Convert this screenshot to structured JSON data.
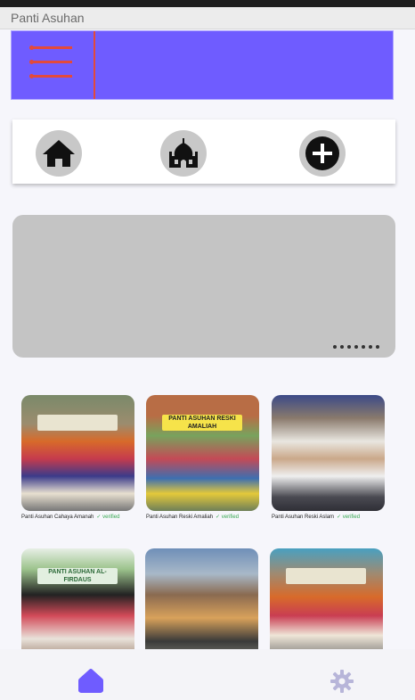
{
  "window": {
    "title": "Panti Asuhan"
  },
  "header": {
    "menu_icon": "hamburger-menu-icon",
    "background": "#6f5cff",
    "accent": "#e24a3b"
  },
  "nav": [
    {
      "icon": "home-icon"
    },
    {
      "icon": "mosque-icon"
    },
    {
      "icon": "add-circle-icon"
    }
  ],
  "banner": {
    "dot_count": 7
  },
  "panti": [
    {
      "name": "Panti Asuhan Cahaya Amanah",
      "badge": "✓ verified"
    },
    {
      "name": "Panti Asuhan Reski Amaliah",
      "badge": "✓ verified",
      "sign": "PANTI ASUHAN RESKI AMALIAH"
    },
    {
      "name": "Panti Asuhan Reski Aslam",
      "badge": "✓ verified"
    },
    {
      "name": "",
      "badge": "",
      "sign": "PANTI ASUHAN AL-FIRDAUS"
    },
    {
      "name": "",
      "badge": ""
    },
    {
      "name": "",
      "badge": ""
    }
  ],
  "bottom_nav": [
    {
      "icon": "home-icon",
      "active": true,
      "color": "#6f5cff"
    },
    {
      "icon": "gear-icon",
      "active": false,
      "color": "#b7b5d9"
    }
  ]
}
